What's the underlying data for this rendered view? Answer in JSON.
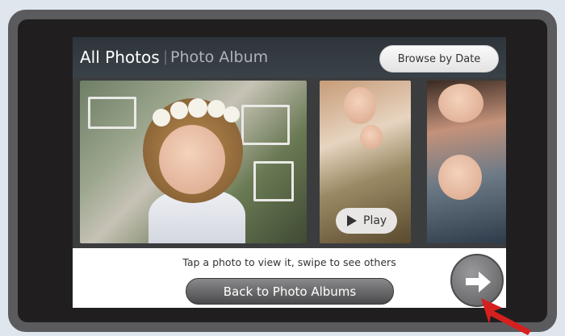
{
  "header": {
    "title": "All Photos",
    "separator": "|",
    "subtitle": "Photo Album",
    "browse_label": "Browse by Date"
  },
  "gallery": {
    "play_label": "Play"
  },
  "footer": {
    "hint": "Tap a photo to view it, swipe to see others",
    "back_label": "Back to Photo Albums"
  },
  "icons": {
    "next": "arrow-right-icon",
    "play": "play-icon",
    "pointer": "red-arrow-pointer-icon"
  },
  "colors": {
    "pointer_red": "#d61f1f",
    "screen_header": "#353c43",
    "bezel": "#5b5b5d"
  }
}
